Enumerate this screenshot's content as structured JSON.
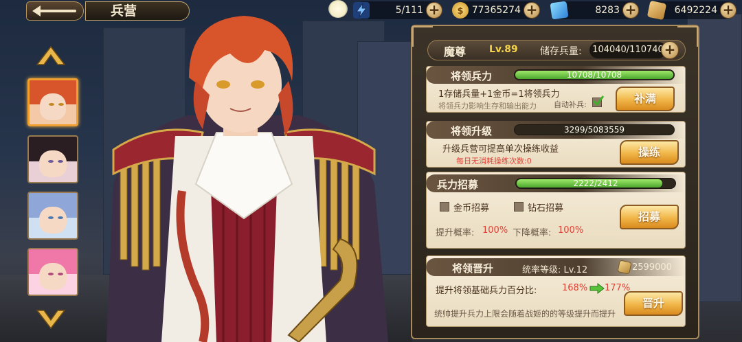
{
  "header": {
    "title": "兵营",
    "resources": [
      {
        "name": "energy",
        "icon": "lightning-icon",
        "value": "5/111",
        "color": "#3d7bd8"
      },
      {
        "name": "gold",
        "icon": "gold-coin-icon",
        "value": "77365274",
        "color": "#e8b23a"
      },
      {
        "name": "diamond",
        "icon": "blue-gem-card-icon",
        "value": "8283",
        "color": "#3aa3e8"
      },
      {
        "name": "token",
        "icon": "bronze-token-icon",
        "value": "6492224",
        "color": "#c9923a"
      }
    ]
  },
  "heroes": [
    {
      "name": "hero-1",
      "active": true,
      "hair": "#d8542a",
      "eye": "#c08a20"
    },
    {
      "name": "hero-2",
      "active": false,
      "hair": "#2a1e22",
      "eye": "#6a5a9a"
    },
    {
      "name": "hero-3",
      "active": false,
      "hair": "#8fa6d8",
      "eye": "#4f7ab0"
    },
    {
      "name": "hero-4",
      "active": false,
      "hair": "#f078a8",
      "eye": "#b04a7a"
    }
  ],
  "panel": {
    "name": "魔尊",
    "level": "Lv.89",
    "storage_label": "储存兵量:",
    "storage_value": "104040/110740",
    "troops": {
      "title": "将领兵力",
      "bar_text": "10708/10708",
      "fill": 1.0,
      "line1": "1存储兵量+1金币=1将领兵力",
      "line2": "将领兵力影响生存和输出能力",
      "auto_label": "自动补兵:",
      "auto_checked": true,
      "button": "补满"
    },
    "upgrade": {
      "title": "将领升级",
      "bar_text": "3299/5083559",
      "fill": 0.0006,
      "line1": "升级兵营可提高单次操练收益",
      "line2": "每日无消耗操练次数:0",
      "button": "操练"
    },
    "recruit": {
      "title": "兵力招募",
      "bar_text": "2222/2412",
      "fill": 0.921,
      "opt1": "金币招募",
      "opt2": "钻石招募",
      "up_label": "提升概率:",
      "up_value": "100%",
      "down_label": "下降概率:",
      "down_value": "100%",
      "button": "招募"
    },
    "promote": {
      "title": "将领晋升",
      "rank_label": "统率等级: Lv.12",
      "cost": "2599000",
      "line1_label": "提升将领基础兵力百分比:",
      "from": "168%",
      "to": "177%",
      "line2": "统帅提升兵力上限会随着战姬的的等级提升而提升",
      "button": "晋升"
    }
  }
}
